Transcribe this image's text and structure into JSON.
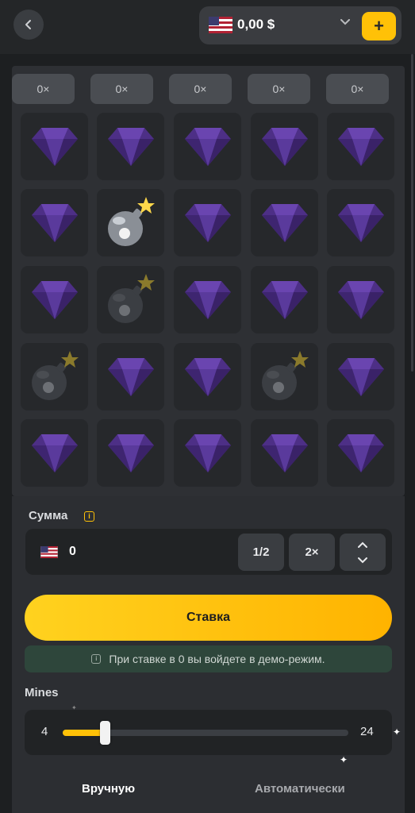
{
  "header": {
    "back_icon": "chevron-left-icon",
    "balance": "0,00 $",
    "currency_flag": "us-flag",
    "add_label": "+"
  },
  "board": {
    "multipliers": [
      "0×",
      "0×",
      "0×",
      "0×",
      "0×"
    ],
    "grid": [
      [
        "gem",
        "gem",
        "gem",
        "gem",
        "gem"
      ],
      [
        "gem",
        "mine-hit",
        "gem",
        "gem",
        "gem"
      ],
      [
        "gem",
        "mine",
        "gem",
        "gem",
        "gem"
      ],
      [
        "mine",
        "gem",
        "gem",
        "mine",
        "gem"
      ],
      [
        "gem",
        "gem",
        "gem",
        "gem",
        "gem"
      ]
    ]
  },
  "bet": {
    "sum_label": "Сумма",
    "amount": "0",
    "half_label": "1/2",
    "double_label": "2×",
    "bet_button": "Ставка",
    "demo_note": "При ставке в 0 вы войдете в демо-режим."
  },
  "mines": {
    "label": "Mines",
    "value": 4,
    "min": "4",
    "max": "24",
    "range": [
      1,
      24
    ]
  },
  "modes": {
    "manual": "Вручную",
    "auto": "Автоматически",
    "active": "manual"
  },
  "colors": {
    "accent": "#ffc107",
    "gem": "#5b3a9c",
    "background": "#1d1f21"
  }
}
